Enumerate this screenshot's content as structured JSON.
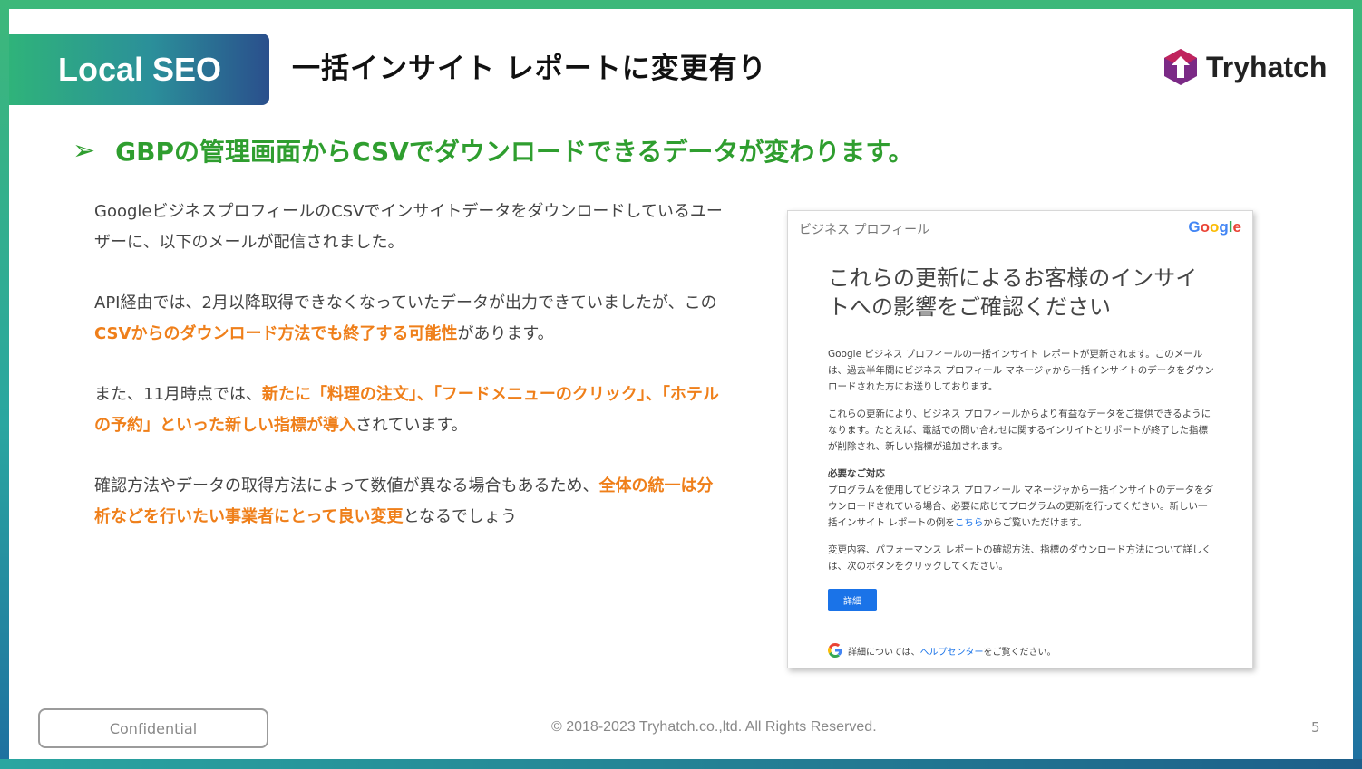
{
  "header": {
    "tag": "Local SEO",
    "title": "一括インサイト レポートに変更有り",
    "logo_text": "Tryhatch"
  },
  "heading": {
    "arrow": "➢",
    "text": "GBPの管理画面からCSVでダウンロードできるデータが変わります。"
  },
  "body": {
    "p1": "GoogleビジネスプロフィールのCSVでインサイトデータをダウンロードしているユーザーに、以下のメールが配信されました。",
    "p2_a": "API経由では、2月以降取得できなくなっていたデータが出力できていましたが、この",
    "p2_hl": "CSVからのダウンロード方法でも終了する可能性",
    "p2_b": "があります。",
    "p3_a": "また、11月時点では、",
    "p3_hl": "新たに「料理の注文」、「フードメニューのクリック」、「ホテルの予約」といった新しい指標が導入",
    "p3_b": "されています。",
    "p4_a": "確認方法やデータの取得方法によって数値が異なる場合もあるため、",
    "p4_hl": "全体の統一は分析などを行いたい事業者にとって良い変更",
    "p4_b": "となるでしょう"
  },
  "email": {
    "header_left": "ビジネス プロフィール",
    "header_brand": "Google",
    "headline": "これらの更新によるお客様のインサイトへの影響をご確認ください",
    "para1": "Google ビジネス プロフィールの一括インサイト レポートが更新されます。このメールは、過去半年間にビジネス プロフィール マネージャから一括インサイトのデータをダウンロードされた方にお送りしております。",
    "para2": "これらの更新により、ビジネス プロフィールからより有益なデータをご提供できるようになります。たとえば、電話での問い合わせに関するインサイトとサポートが終了した指標が削除され、新しい指標が追加されます。",
    "sub_title": "必要なご対応",
    "para3_a": "プログラムを使用してビジネス プロフィール マネージャから一括インサイトのデータをダウンロードされている場合、必要に応じてプログラムの更新を行ってください。新しい一括インサイト レポートの例を",
    "para3_link": "こちら",
    "para3_b": "からご覧いただけます。",
    "para4": "変更内容、パフォーマンス レポートの確認方法、指標のダウンロード方法について詳しくは、次のボタンをクリックしてください。",
    "button": "詳細",
    "footer_a": "詳細については、",
    "footer_link": "ヘルプセンター",
    "footer_b": "をご覧ください。"
  },
  "footer": {
    "confidential": "Confidential",
    "copyright": "© 2018-2023 Tryhatch.co.,ltd. All Rights Reserved.",
    "page": "5"
  }
}
